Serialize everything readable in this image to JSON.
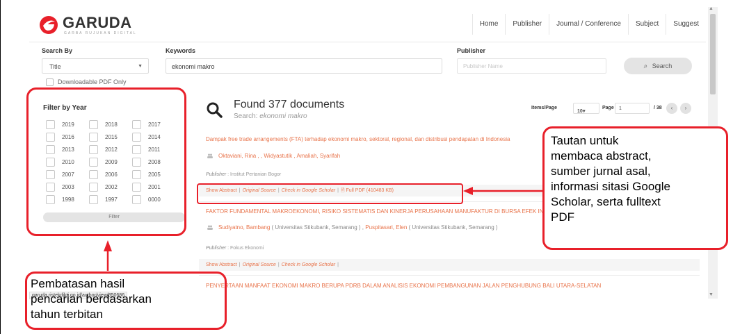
{
  "header": {
    "logo_name": "GARUDA",
    "logo_tagline": "GARBA RUJUKAN DIGITAL",
    "nav": [
      "Home",
      "Publisher",
      "Journal / Conference",
      "Subject",
      "Suggest"
    ]
  },
  "search": {
    "search_by_label": "Search By",
    "search_by_value": "Title",
    "keywords_label": "Keywords",
    "keywords_value": "ekonomi makro",
    "publisher_label": "Publisher",
    "publisher_placeholder": "Publisher Name",
    "search_button": "Search",
    "downloadable_label": "Downloadable PDF Only"
  },
  "filter": {
    "title": "Filter by Year",
    "years": [
      "2019",
      "2018",
      "2017",
      "2016",
      "2015",
      "2014",
      "2013",
      "2012",
      "2011",
      "2010",
      "2009",
      "2008",
      "2007",
      "2006",
      "2005",
      "2003",
      "2002",
      "2001",
      "1998",
      "1997",
      "0000"
    ],
    "button": "Filter"
  },
  "results_header": {
    "found": "Found 377 documents",
    "search_label": "Search:",
    "search_term": "ekonomi makro"
  },
  "pager": {
    "items_label": "Items/Page",
    "items_value": "10",
    "page_label": "Page",
    "page_value": "1",
    "total": "/ 38"
  },
  "results": [
    {
      "title": "Dampak free trade arrangements (FTA) terhadap ekonomi makro, sektoral, regional, dan distribusi pendapatan di Indonesia",
      "authors": "Oktaviani, Rina , , Widyastutik , Amaliah, Syarifah",
      "publisher_label": "Publisher",
      "publisher": "Institut Pertanian Bogor",
      "links": {
        "abstract": "Show Abstract",
        "original": "Original Source",
        "scholar": "Check in Google Scholar",
        "pdf": "Full PDF (410483 KB)"
      }
    },
    {
      "title": "FAKTOR FUNDAMENTAL MAKROEKONOMI, RISIKO SISTEMATIS DAN KINERJA PERUSAHAAN MANUFAKTUR DI BURSA EFEK INDONESIA",
      "authors_html": [
        "Sudiyatno, Bambang",
        " ( Universitas Stikubank, Semarang ) , ",
        "Puspitasari, Elen",
        " ( Universitas Stikubank, Semarang )"
      ],
      "publisher_label": "Publisher",
      "publisher": "Fokus Ekonomi",
      "links": {
        "abstract": "Show Abstract",
        "original": "Original Source",
        "scholar": "Check in Google Scholar"
      }
    },
    {
      "title": "PENYERTAAN MANFAAT EKONOMI MAKRO BERUPA PDRB DALAM ANALISIS EKONOMI PEMBANGUNAN JALAN PENGHUBUNG BALI UTARA-SELATAN"
    }
  ],
  "status_url": "garuda.ristekdikti.go.id/author/view/350686",
  "annotations": {
    "links_note": [
      "Tautan untuk",
      "membaca abstract,",
      "sumber jurnal asal,",
      "informasi sitasi Google",
      "Scholar, serta fulltext",
      "PDF"
    ],
    "year_note": [
      "Pembatasan hasil",
      "pencarian berdasarkan",
      "tahun terbitan"
    ]
  },
  "colors": {
    "accent": "#e8734a",
    "annotation": "#e8202a",
    "logo": "#e8202a"
  }
}
